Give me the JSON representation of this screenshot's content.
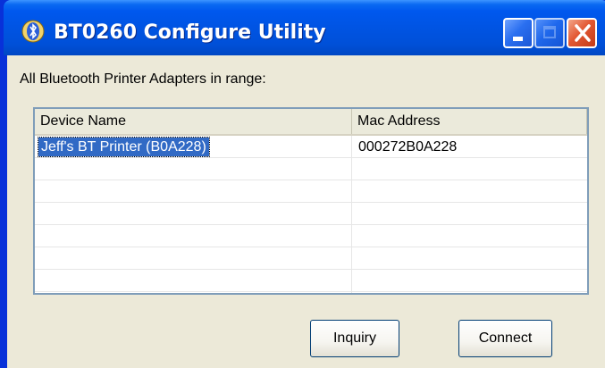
{
  "window": {
    "title": "BT0260 Configure Utility",
    "icon": "bluetooth-app-icon",
    "controls": {
      "minimize": "minimize-icon",
      "maximize": "maximize-icon",
      "close": "close-icon"
    }
  },
  "caption": "All Bluetooth Printer Adapters in range:",
  "list": {
    "columns": [
      "Device Name",
      "Mac Address"
    ],
    "rows": [
      {
        "name": "Jeff's BT Printer (B0A228)",
        "mac": "000272B0A228",
        "selected": true
      }
    ]
  },
  "buttons": {
    "inquiry": "Inquiry",
    "connect": "Connect"
  },
  "colors": {
    "titlebar": "#0054e3",
    "client": "#ece9d8",
    "selection": "#316ac5",
    "close_button": "#e35833"
  }
}
